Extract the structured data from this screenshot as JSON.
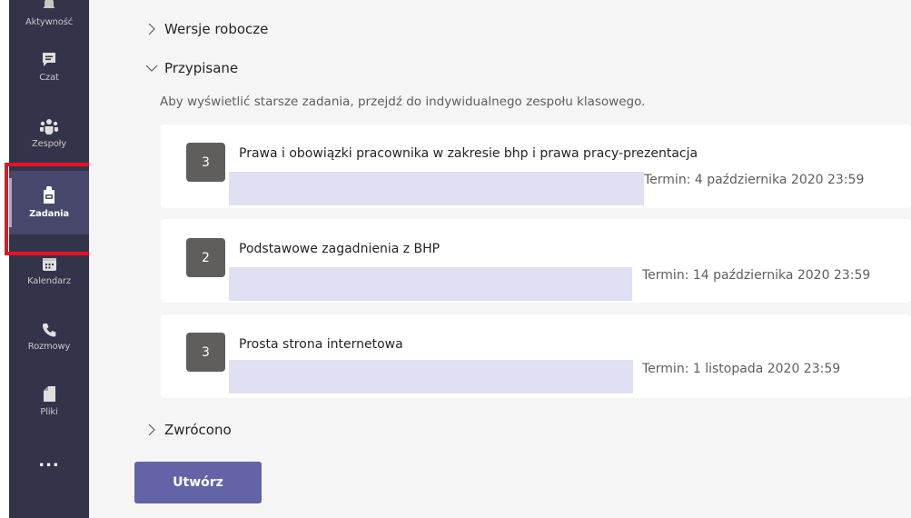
{
  "rail": {
    "items": [
      {
        "label": "Aktywność",
        "icon": "bell-icon"
      },
      {
        "label": "Czat",
        "icon": "chat-icon"
      },
      {
        "label": "Zespoły",
        "icon": "teams-icon"
      },
      {
        "label": "Zadania",
        "icon": "assignments-icon",
        "active": true
      },
      {
        "label": "Kalendarz",
        "icon": "calendar-icon"
      },
      {
        "label": "Rozmowy",
        "icon": "phone-icon"
      },
      {
        "label": "Pliki",
        "icon": "file-icon"
      },
      {
        "label": "...",
        "icon": "more-icon"
      }
    ],
    "highlight_color": "#e81123"
  },
  "sections": {
    "drafts": {
      "title": "Wersje robocze",
      "expanded": false
    },
    "assigned": {
      "title": "Przypisane",
      "expanded": true,
      "hint": "Aby wyświetlić starsze zadania, przejdź do indywidualnego zespołu klasowego."
    },
    "returned": {
      "title": "Zwrócono",
      "expanded": false
    }
  },
  "assignments": [
    {
      "count": "3",
      "title": "Prawa i obowiązki pracownika w zakresie bhp i prawa pracy-prezentacja",
      "due": "Termin: 4 października 2020 23:59"
    },
    {
      "count": "2",
      "title": "Podstawowe zagadnienia z BHP",
      "due": "Termin: 14 października 2020 23:59"
    },
    {
      "count": "3",
      "title": "Prosta strona internetowa",
      "due": "Termin: 1 listopada 2020 23:59"
    }
  ],
  "actions": {
    "create_label": "Utwórz"
  },
  "colors": {
    "rail_bg": "#33344a",
    "accent": "#6264a7",
    "badge_bg": "#605e5c",
    "redacted_bar": "#dfe0f3"
  }
}
